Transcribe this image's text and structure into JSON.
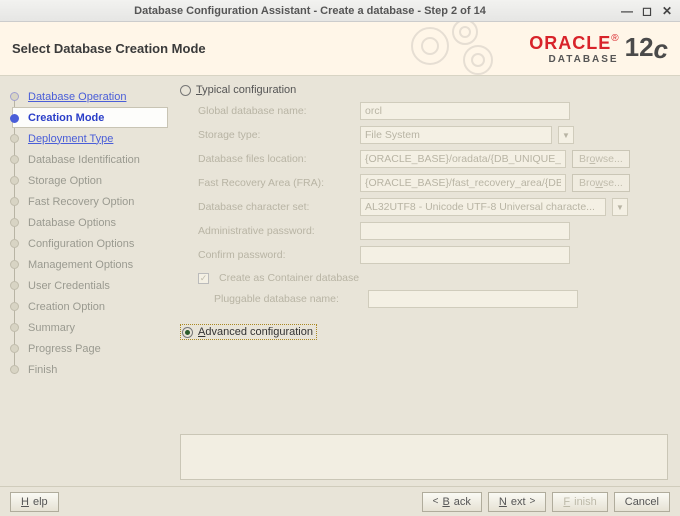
{
  "titlebar": "Database Configuration Assistant - Create a database - Step 2 of 14",
  "header": {
    "title": "Select Database Creation Mode",
    "brand": "ORACLE",
    "subbrand": "DATABASE",
    "version": "12",
    "version_suffix": "c"
  },
  "sidebar": {
    "items": [
      {
        "label": "Database Operation",
        "state": "done",
        "interactable": true
      },
      {
        "label": "Creation Mode",
        "state": "active",
        "interactable": true
      },
      {
        "label": "Deployment Type",
        "state": "link",
        "interactable": true
      },
      {
        "label": "Database Identification",
        "state": "future",
        "interactable": false
      },
      {
        "label": "Storage Option",
        "state": "future",
        "interactable": false
      },
      {
        "label": "Fast Recovery Option",
        "state": "future",
        "interactable": false
      },
      {
        "label": "Database Options",
        "state": "future",
        "interactable": false
      },
      {
        "label": "Configuration Options",
        "state": "future",
        "interactable": false
      },
      {
        "label": "Management Options",
        "state": "future",
        "interactable": false
      },
      {
        "label": "User Credentials",
        "state": "future",
        "interactable": false
      },
      {
        "label": "Creation Option",
        "state": "future",
        "interactable": false
      },
      {
        "label": "Summary",
        "state": "future",
        "interactable": false
      },
      {
        "label": "Progress Page",
        "state": "future",
        "interactable": false
      },
      {
        "label": "Finish",
        "state": "future",
        "interactable": false
      }
    ]
  },
  "main": {
    "radios": {
      "typical": {
        "label_pre": "T",
        "label_rest": "ypical configuration",
        "selected": false
      },
      "advanced": {
        "label_pre": "A",
        "label_rest": "dvanced configuration",
        "selected": true
      }
    },
    "form": {
      "gdbname_label": "Global database name:",
      "gdbname_value": "orcl",
      "storage_label": "Storage type:",
      "storage_value": "File System",
      "dbfiles_label": "Database files location:",
      "dbfiles_value": "{ORACLE_BASE}/oradata/{DB_UNIQUE_NAM",
      "fra_label": "Fast Recovery Area (FRA):",
      "fra_value": "{ORACLE_BASE}/fast_recovery_area/{DB",
      "charset_label": "Database character set:",
      "charset_value": "AL32UTF8 - Unicode UTF-8 Universal characte...",
      "admin_label": "Administrative password:",
      "admin_value": "",
      "confirm_label": "Confirm password:",
      "confirm_value": "",
      "browse1": "Browse...",
      "browse2": "Browse...",
      "container_label": "Create as Container database",
      "container_checked": true,
      "pdb_label": "Pluggable database name:",
      "pdb_value": ""
    }
  },
  "footer": {
    "help": "Help",
    "back": "Back",
    "next": "Next",
    "finish": "Finish",
    "cancel": "Cancel"
  }
}
